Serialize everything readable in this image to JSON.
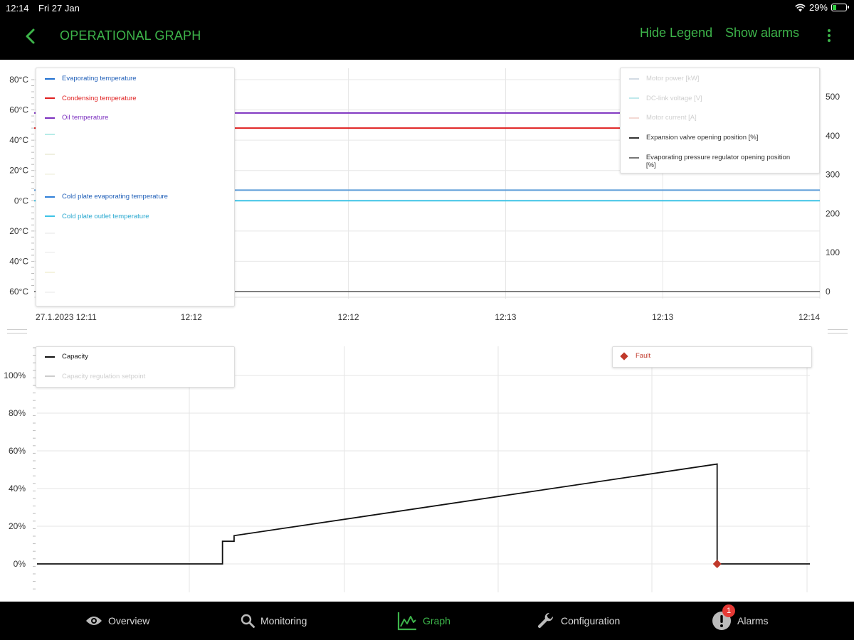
{
  "status_bar": {
    "time": "12:14",
    "date": "Fri 27 Jan",
    "battery": "29%",
    "battery_level": 0.29
  },
  "header": {
    "title": "OPERATIONAL GRAPH",
    "hide_legend_label": "Hide Legend",
    "show_alarms_label": "Show alarms",
    "back_icon": "chevron-left-icon",
    "more_icon": "more-vertical-icon"
  },
  "colors": {
    "accent": "#3db44a",
    "background_dark": "#000000",
    "fault": "#c0392b"
  },
  "chart_data": [
    {
      "type": "line",
      "x": [
        "27.1.2023 12:11",
        "12:12",
        "12:12",
        "12:13",
        "12:13",
        "12:14"
      ],
      "left_axis": {
        "ticks": [
          "80°C",
          "60°C",
          "40°C",
          "20°C",
          "0°C",
          "20°C",
          "40°C",
          "60°C"
        ],
        "ylim": [
          -60,
          80
        ]
      },
      "right_axis": {
        "ticks": [
          "500",
          "400",
          "300",
          "200",
          "100",
          "0"
        ],
        "ylim": [
          0,
          500
        ]
      },
      "legend_left": [
        {
          "name": "Evaporating temperature",
          "color": "#1f6fd0"
        },
        {
          "name": "Condensing temperature",
          "color": "#e02020"
        },
        {
          "name": "Oil temperature",
          "color": "#7b2fbf"
        },
        {
          "name": "",
          "color": "#b7ece8"
        },
        {
          "name": "",
          "color": "#efefe0"
        },
        {
          "name": "",
          "color": "#f5f5ea"
        },
        {
          "name": "Cold plate evaporating temperature",
          "color": "#2f7fd8"
        },
        {
          "name": "Cold plate outlet temperature",
          "color": "#3ec3e6"
        },
        {
          "name": "",
          "color": "#f2f2f2"
        },
        {
          "name": "",
          "color": "#f3f3f3"
        },
        {
          "name": "",
          "color": "#f5f3df"
        },
        {
          "name": "",
          "color": "#f3f3f3"
        }
      ],
      "legend_right": [
        {
          "name": "Motor power [kW]",
          "color": "#d3dbe4",
          "faded": true
        },
        {
          "name": "DC-link voltage [V]",
          "color": "#bfe9ec",
          "faded": true
        },
        {
          "name": "Motor current [A]",
          "color": "#f4d9d4",
          "faded": true
        },
        {
          "name": "Expansion valve opening position [%]",
          "color": "#333333",
          "faded": false
        },
        {
          "name": "Evaporating pressure regulator opening position [%]",
          "color": "#777777",
          "faded": false
        }
      ],
      "series": [
        {
          "name": "Oil temperature",
          "axis": "left",
          "y": [
            58,
            58
          ],
          "color": "#7b2fbf"
        },
        {
          "name": "Condensing temperature",
          "axis": "left",
          "y": [
            48,
            48
          ],
          "color": "#e02020"
        },
        {
          "name": "Cold plate evaporating temperature",
          "axis": "left",
          "y": [
            7,
            7
          ],
          "color": "#5b9bd8"
        },
        {
          "name": "Cold plate outlet temperature",
          "axis": "left",
          "y": [
            0,
            0
          ],
          "color": "#3ec3e6"
        },
        {
          "name": "Expansion valve opening position [%]",
          "axis": "right",
          "y": [
            0,
            0
          ],
          "color": "#555555"
        }
      ]
    },
    {
      "type": "line",
      "y_ticks": [
        "100%",
        "80%",
        "60%",
        "40%",
        "20%",
        "0%"
      ],
      "ylim": [
        0,
        100
      ],
      "legend_left": [
        {
          "name": "Capacity",
          "color": "#111111",
          "faded": false
        },
        {
          "name": "Capacity regulation setpoint",
          "color": "#cccccc",
          "faded": true
        }
      ],
      "legend_right": [
        {
          "name": "Fault",
          "color": "#c0392b",
          "marker": "diamond"
        }
      ],
      "series": [
        {
          "name": "Capacity",
          "points": [
            [
              0,
              0
            ],
            [
              0.24,
              0
            ],
            [
              0.24,
              12
            ],
            [
              0.255,
              12
            ],
            [
              0.255,
              15
            ],
            [
              0.88,
              53
            ],
            [
              0.88,
              0
            ],
            [
              1,
              0
            ]
          ]
        }
      ],
      "fault_at": 0.88
    }
  ],
  "bottom_nav": {
    "items": [
      {
        "label": "Overview",
        "icon": "eye-icon"
      },
      {
        "label": "Monitoring",
        "icon": "search-icon"
      },
      {
        "label": "Graph",
        "icon": "graph-icon",
        "active": true
      },
      {
        "label": "Configuration",
        "icon": "wrench-icon"
      },
      {
        "label": "Alarms",
        "icon": "alert-icon"
      }
    ],
    "alarm_count": "1"
  }
}
